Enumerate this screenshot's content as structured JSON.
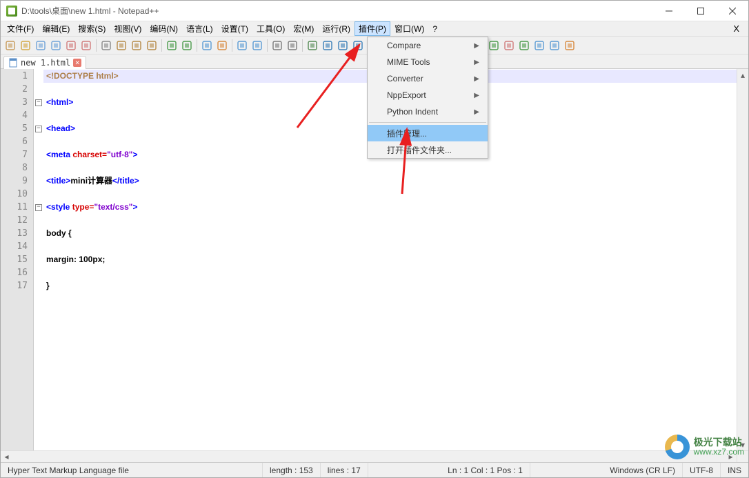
{
  "title": "D:\\tools\\桌面\\new 1.html - Notepad++",
  "menus": [
    "文件(F)",
    "编辑(E)",
    "搜索(S)",
    "视图(V)",
    "编码(N)",
    "语言(L)",
    "设置(T)",
    "工具(O)",
    "宏(M)",
    "运行(R)",
    "插件(P)",
    "窗口(W)",
    "?"
  ],
  "active_menu_index": 10,
  "dropdown": {
    "items": [
      {
        "label": "Compare",
        "submenu": true
      },
      {
        "label": "MIME Tools",
        "submenu": true
      },
      {
        "label": "Converter",
        "submenu": true
      },
      {
        "label": "NppExport",
        "submenu": true
      },
      {
        "label": "Python Indent",
        "submenu": true
      }
    ],
    "separated_items": [
      {
        "label": "插件管理...",
        "highlight": true
      },
      {
        "label": "打开插件文件夹..."
      }
    ]
  },
  "tab": {
    "name": "new 1.html"
  },
  "lines": [
    "1",
    "2",
    "3",
    "4",
    "5",
    "6",
    "7",
    "8",
    "9",
    "10",
    "11",
    "12",
    "13",
    "14",
    "15",
    "16",
    "17"
  ],
  "code": {
    "l1_doctype": "<!DOCTYPE html>",
    "l3_html": "<html>",
    "l5_head": "<head>",
    "l7_meta_open": "<meta ",
    "l7_attr": "charset=",
    "l7_str": "\"utf-8\"",
    "l7_close": ">",
    "l9_title_open": "<title>",
    "l9_text": "mini计算器",
    "l9_title_close": "</title>",
    "l11_style_open": "<style ",
    "l11_attr": "type=",
    "l11_str": "\"text/css\"",
    "l11_close": ">",
    "l13_body": "body {",
    "l15_margin": "margin: 100px;",
    "l17_brace": "}"
  },
  "status": {
    "filetype": "Hyper Text Markup Language file",
    "length": "length : 153",
    "lines": "lines : 17",
    "pos": "Ln : 1    Col : 1    Pos : 1",
    "eol": "Windows (CR LF)",
    "enc": "UTF-8",
    "ins": "INS"
  },
  "watermark": {
    "t1": "极光下载站",
    "t2": "www.xz7.com"
  },
  "toolbar_icons": [
    "new-file",
    "open-file",
    "save",
    "save-all",
    "close",
    "close-all",
    "print",
    "cut",
    "copy",
    "paste",
    "undo",
    "redo",
    "find",
    "replace",
    "zoom-in",
    "zoom-out",
    "sync",
    "wordwrap",
    "show-all",
    "indent-guide",
    "udl",
    "doc-map",
    "doc-list",
    "func-list",
    "folder",
    "monitor",
    "record",
    "play",
    "play-multi",
    "macro1",
    "macro2",
    "macro3",
    "macro4",
    "macro5",
    "macro6"
  ]
}
